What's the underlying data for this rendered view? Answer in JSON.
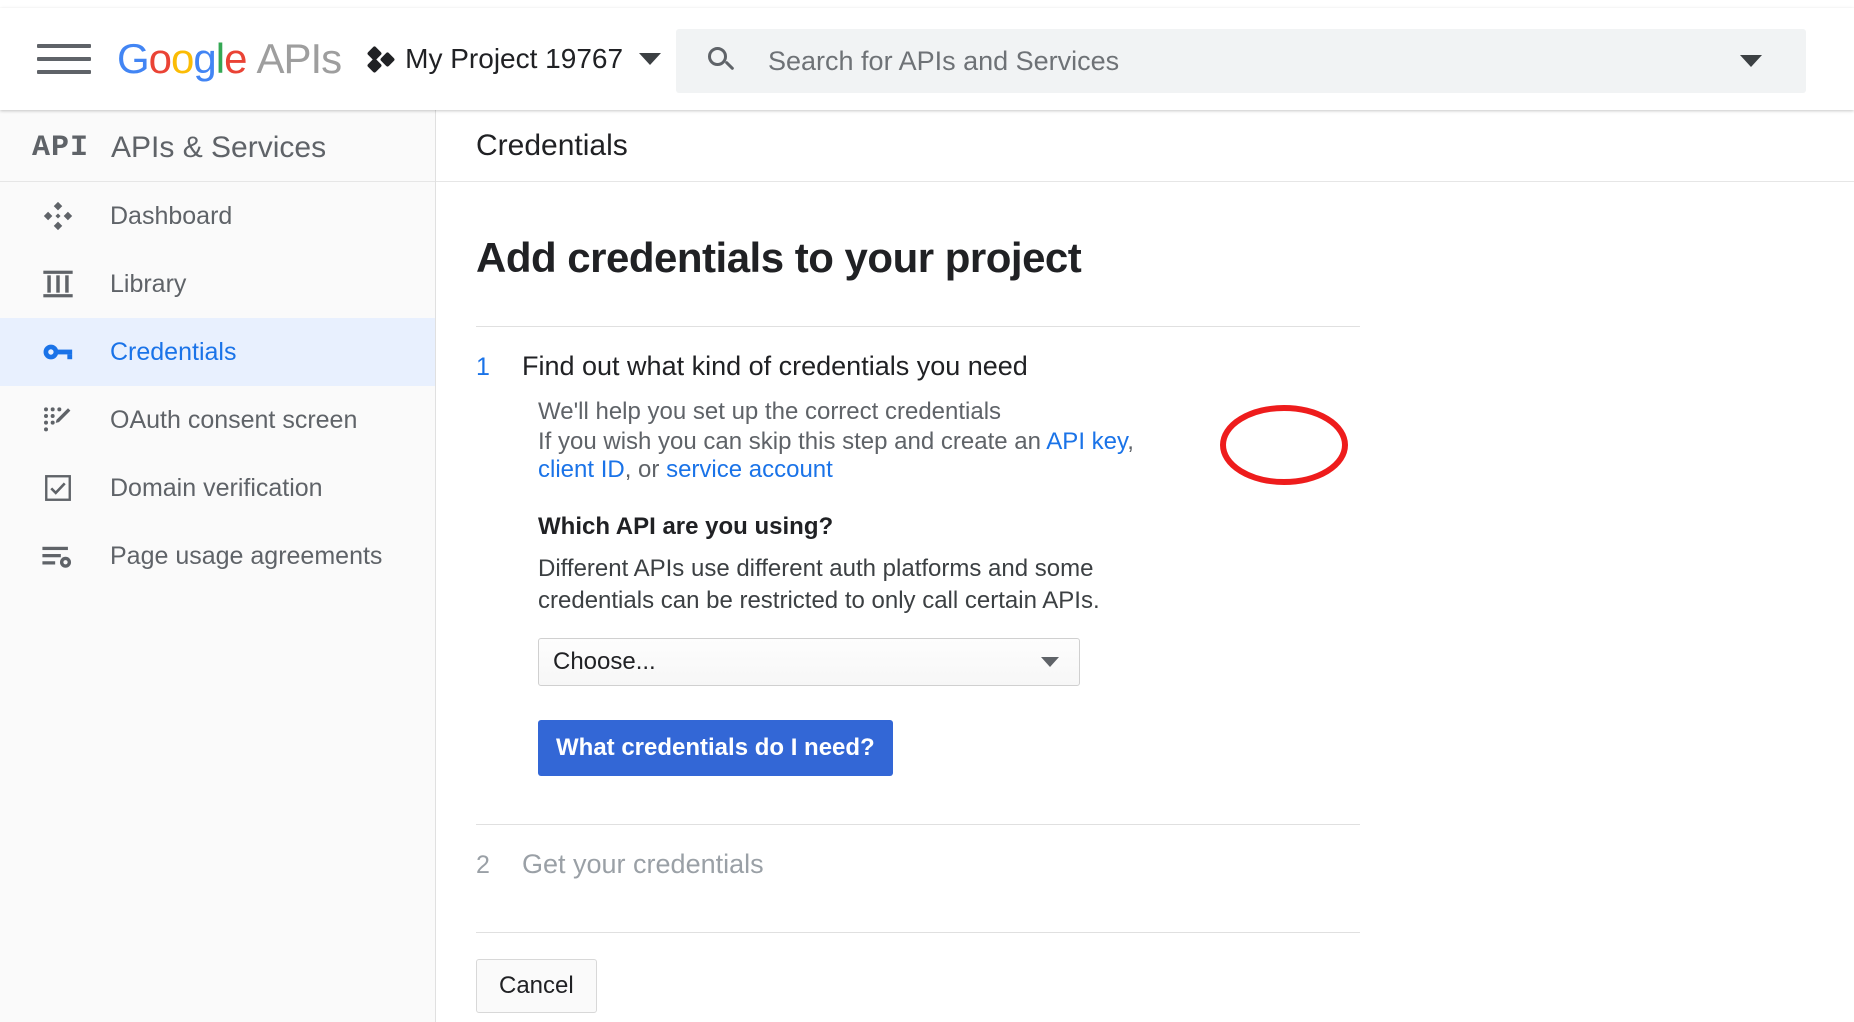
{
  "topbar": {
    "menu_icon": "hamburger-menu-icon",
    "logo_text": "Google APIs",
    "logo_letters": [
      "G",
      "o",
      "o",
      "g",
      "l",
      "e"
    ],
    "logo_suffix": "APIs",
    "project_name": "My Project 19767",
    "project_icon": "project-dots-icon",
    "project_caret": "chevron-down-icon",
    "search": {
      "icon": "search-icon",
      "value": "",
      "placeholder": "Search for APIs and Services",
      "caret": "chevron-down-icon"
    }
  },
  "sidebar": {
    "badge": "API",
    "title": "APIs & Services",
    "items": [
      {
        "label": "Dashboard",
        "icon": "dashboard-diamond-icon",
        "active": false
      },
      {
        "label": "Library",
        "icon": "library-icon",
        "active": false
      },
      {
        "label": "Credentials",
        "icon": "key-icon",
        "active": true
      },
      {
        "label": "OAuth consent screen",
        "icon": "oauth-consent-icon",
        "active": false
      },
      {
        "label": "Domain verification",
        "icon": "checkbox-check-icon",
        "active": false
      },
      {
        "label": "Page usage agreements",
        "icon": "list-settings-icon",
        "active": false
      }
    ]
  },
  "main": {
    "page_title": "Credentials",
    "heading": "Add credentials to your project",
    "step1": {
      "number": "1",
      "title": "Find out what kind of credentials you need",
      "line1": "We'll help you set up the correct credentials",
      "line2_prefix": "If you wish you can skip this step and create an ",
      "link_api_key": "API key",
      "comma1": ", ",
      "link_client_id": "client ID",
      "comma2": ", or",
      "link_service_account": "service account",
      "subhead": "Which API are you using?",
      "description": "Different APIs use different auth platforms and some credentials can be restricted to only call certain APIs.",
      "select_value": "Choose...",
      "select_caret": "chevron-down-icon",
      "primary_button": "What credentials do I need?"
    },
    "step2": {
      "number": "2",
      "title": "Get your credentials"
    },
    "cancel_button": "Cancel"
  },
  "annotation": {
    "shape": "red-ellipse-highlight",
    "target": "client ID",
    "color": "#ee1c1c"
  },
  "colors": {
    "accent_blue": "#1a73e8",
    "button_blue": "#3367d6",
    "active_row": "#e8f0fe",
    "text_primary": "#202124",
    "text_secondary": "#5f6368",
    "annotation_red": "#ee1c1c"
  }
}
